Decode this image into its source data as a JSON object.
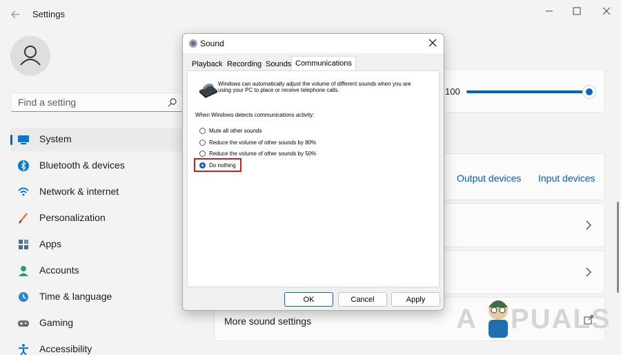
{
  "window": {
    "title": "Settings"
  },
  "search": {
    "placeholder": "Find a setting"
  },
  "sidebar": {
    "items": [
      {
        "label": "System",
        "active": true
      },
      {
        "label": "Bluetooth & devices"
      },
      {
        "label": "Network & internet"
      },
      {
        "label": "Personalization"
      },
      {
        "label": "Apps"
      },
      {
        "label": "Accounts"
      },
      {
        "label": "Time & language"
      },
      {
        "label": "Gaming"
      },
      {
        "label": "Accessibility"
      }
    ]
  },
  "main": {
    "volume": {
      "value": "100",
      "level": 1.0
    },
    "output_devices": "Output devices",
    "input_devices": "Input devices",
    "more_sound_settings": "More sound settings"
  },
  "watermark": {
    "text": "A PPUALS"
  },
  "dialog": {
    "title": "Sound",
    "tabs": [
      "Playback",
      "Recording",
      "Sounds",
      "Communications"
    ],
    "active_tab": "Communications",
    "description": "Windows can automatically adjust the volume of different sounds when you are using your PC to place or receive telephone calls.",
    "heading": "When Windows detects communications activity:",
    "options": [
      {
        "label": "Mute all other sounds",
        "checked": false
      },
      {
        "label": "Reduce the volume of other sounds by 80%",
        "checked": false
      },
      {
        "label": "Reduce the volume of other sounds by 50%",
        "checked": false
      },
      {
        "label": "Do nothing",
        "checked": true
      }
    ],
    "buttons": {
      "ok": "OK",
      "cancel": "Cancel",
      "apply": "Apply"
    }
  },
  "colors": {
    "accent": "#0067c0",
    "highlight": "#d21e1e"
  }
}
